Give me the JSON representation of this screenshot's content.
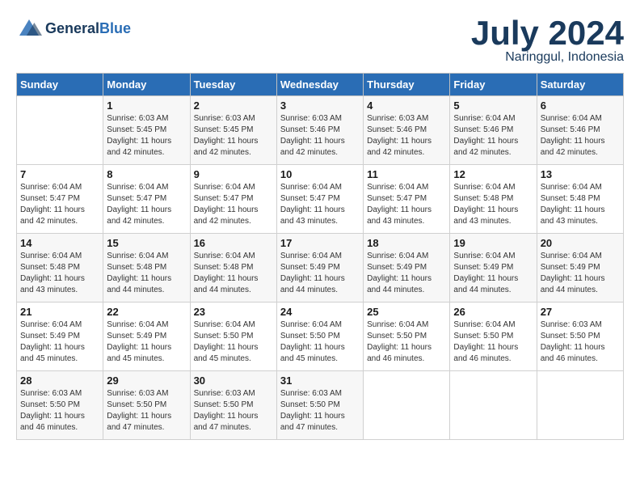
{
  "logo": {
    "line1": "General",
    "line2": "Blue"
  },
  "title": "July 2024",
  "location": "Naringgul, Indonesia",
  "weekdays": [
    "Sunday",
    "Monday",
    "Tuesday",
    "Wednesday",
    "Thursday",
    "Friday",
    "Saturday"
  ],
  "weeks": [
    [
      {
        "num": "",
        "info": ""
      },
      {
        "num": "1",
        "info": "Sunrise: 6:03 AM\nSunset: 5:45 PM\nDaylight: 11 hours\nand 42 minutes."
      },
      {
        "num": "2",
        "info": "Sunrise: 6:03 AM\nSunset: 5:45 PM\nDaylight: 11 hours\nand 42 minutes."
      },
      {
        "num": "3",
        "info": "Sunrise: 6:03 AM\nSunset: 5:46 PM\nDaylight: 11 hours\nand 42 minutes."
      },
      {
        "num": "4",
        "info": "Sunrise: 6:03 AM\nSunset: 5:46 PM\nDaylight: 11 hours\nand 42 minutes."
      },
      {
        "num": "5",
        "info": "Sunrise: 6:04 AM\nSunset: 5:46 PM\nDaylight: 11 hours\nand 42 minutes."
      },
      {
        "num": "6",
        "info": "Sunrise: 6:04 AM\nSunset: 5:46 PM\nDaylight: 11 hours\nand 42 minutes."
      }
    ],
    [
      {
        "num": "7",
        "info": "Sunrise: 6:04 AM\nSunset: 5:47 PM\nDaylight: 11 hours\nand 42 minutes."
      },
      {
        "num": "8",
        "info": "Sunrise: 6:04 AM\nSunset: 5:47 PM\nDaylight: 11 hours\nand 42 minutes."
      },
      {
        "num": "9",
        "info": "Sunrise: 6:04 AM\nSunset: 5:47 PM\nDaylight: 11 hours\nand 42 minutes."
      },
      {
        "num": "10",
        "info": "Sunrise: 6:04 AM\nSunset: 5:47 PM\nDaylight: 11 hours\nand 43 minutes."
      },
      {
        "num": "11",
        "info": "Sunrise: 6:04 AM\nSunset: 5:47 PM\nDaylight: 11 hours\nand 43 minutes."
      },
      {
        "num": "12",
        "info": "Sunrise: 6:04 AM\nSunset: 5:48 PM\nDaylight: 11 hours\nand 43 minutes."
      },
      {
        "num": "13",
        "info": "Sunrise: 6:04 AM\nSunset: 5:48 PM\nDaylight: 11 hours\nand 43 minutes."
      }
    ],
    [
      {
        "num": "14",
        "info": "Sunrise: 6:04 AM\nSunset: 5:48 PM\nDaylight: 11 hours\nand 43 minutes."
      },
      {
        "num": "15",
        "info": "Sunrise: 6:04 AM\nSunset: 5:48 PM\nDaylight: 11 hours\nand 44 minutes."
      },
      {
        "num": "16",
        "info": "Sunrise: 6:04 AM\nSunset: 5:48 PM\nDaylight: 11 hours\nand 44 minutes."
      },
      {
        "num": "17",
        "info": "Sunrise: 6:04 AM\nSunset: 5:49 PM\nDaylight: 11 hours\nand 44 minutes."
      },
      {
        "num": "18",
        "info": "Sunrise: 6:04 AM\nSunset: 5:49 PM\nDaylight: 11 hours\nand 44 minutes."
      },
      {
        "num": "19",
        "info": "Sunrise: 6:04 AM\nSunset: 5:49 PM\nDaylight: 11 hours\nand 44 minutes."
      },
      {
        "num": "20",
        "info": "Sunrise: 6:04 AM\nSunset: 5:49 PM\nDaylight: 11 hours\nand 44 minutes."
      }
    ],
    [
      {
        "num": "21",
        "info": "Sunrise: 6:04 AM\nSunset: 5:49 PM\nDaylight: 11 hours\nand 45 minutes."
      },
      {
        "num": "22",
        "info": "Sunrise: 6:04 AM\nSunset: 5:49 PM\nDaylight: 11 hours\nand 45 minutes."
      },
      {
        "num": "23",
        "info": "Sunrise: 6:04 AM\nSunset: 5:50 PM\nDaylight: 11 hours\nand 45 minutes."
      },
      {
        "num": "24",
        "info": "Sunrise: 6:04 AM\nSunset: 5:50 PM\nDaylight: 11 hours\nand 45 minutes."
      },
      {
        "num": "25",
        "info": "Sunrise: 6:04 AM\nSunset: 5:50 PM\nDaylight: 11 hours\nand 46 minutes."
      },
      {
        "num": "26",
        "info": "Sunrise: 6:04 AM\nSunset: 5:50 PM\nDaylight: 11 hours\nand 46 minutes."
      },
      {
        "num": "27",
        "info": "Sunrise: 6:03 AM\nSunset: 5:50 PM\nDaylight: 11 hours\nand 46 minutes."
      }
    ],
    [
      {
        "num": "28",
        "info": "Sunrise: 6:03 AM\nSunset: 5:50 PM\nDaylight: 11 hours\nand 46 minutes."
      },
      {
        "num": "29",
        "info": "Sunrise: 6:03 AM\nSunset: 5:50 PM\nDaylight: 11 hours\nand 47 minutes."
      },
      {
        "num": "30",
        "info": "Sunrise: 6:03 AM\nSunset: 5:50 PM\nDaylight: 11 hours\nand 47 minutes."
      },
      {
        "num": "31",
        "info": "Sunrise: 6:03 AM\nSunset: 5:50 PM\nDaylight: 11 hours\nand 47 minutes."
      },
      {
        "num": "",
        "info": ""
      },
      {
        "num": "",
        "info": ""
      },
      {
        "num": "",
        "info": ""
      }
    ]
  ]
}
